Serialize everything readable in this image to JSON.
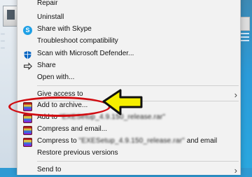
{
  "menu": {
    "items": [
      {
        "id": "repair",
        "label": "Repair"
      },
      {
        "id": "uninstall",
        "label": "Uninstall"
      },
      {
        "id": "skype",
        "label": "Share with Skype"
      },
      {
        "id": "troubleshoot",
        "label": "Troubleshoot compatibility"
      },
      {
        "id": "defender",
        "label": "Scan with Microsoft Defender..."
      },
      {
        "id": "share",
        "label": "Share"
      },
      {
        "id": "openwith",
        "label": "Open with..."
      },
      {
        "id": "giveaccess",
        "label": "Give access to"
      },
      {
        "id": "addarchive",
        "label": "Add to archive..."
      },
      {
        "id": "addto",
        "label": "Add to "
      },
      {
        "id": "compressemail",
        "label": "Compress and email..."
      },
      {
        "id": "compressto",
        "label": "Compress to ",
        "suffix": " and email"
      },
      {
        "id": "restore",
        "label": "Restore previous versions"
      },
      {
        "id": "sendto",
        "label": "Send to"
      }
    ]
  },
  "icons": {
    "skype": "skype-icon",
    "defender": "shield-icon",
    "share": "share-icon",
    "winrar": "winrar-icon"
  },
  "colors": {
    "highlight": "#d10d12",
    "arrow_fill": "#f5ee00"
  },
  "blurred": {
    "addto_name": "\"EXESetup_4.9.150_release.rar\"",
    "compressto_name": "\"EXESetup_4.9.150_release.rar\""
  },
  "desktop": {
    "left_text": [
      "...",
      "...",
      "..."
    ]
  }
}
